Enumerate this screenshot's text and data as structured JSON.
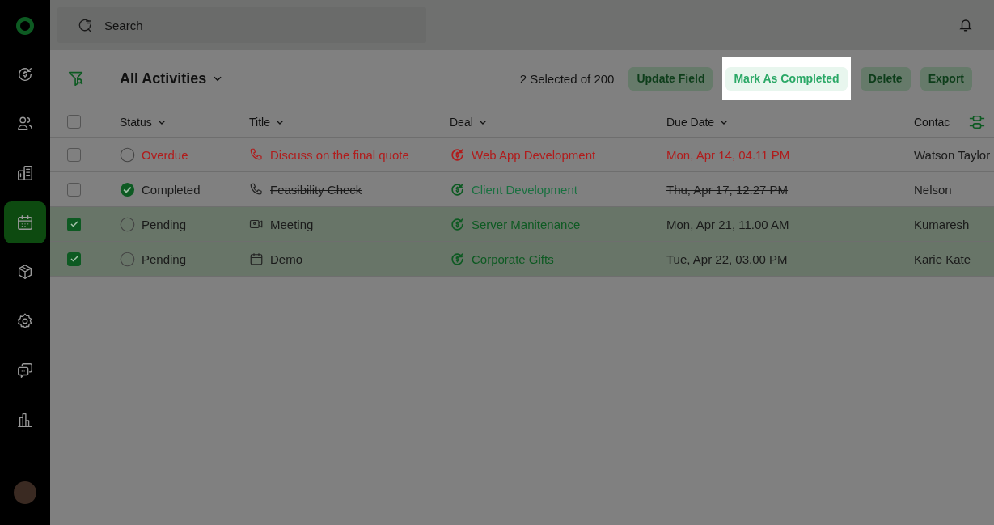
{
  "sidebar": {
    "items": [
      {
        "kind": "deals",
        "selected": false
      },
      {
        "kind": "contacts",
        "selected": false
      },
      {
        "kind": "companies",
        "selected": false
      },
      {
        "kind": "activities",
        "selected": true
      },
      {
        "kind": "products",
        "selected": false
      },
      {
        "kind": "settings",
        "selected": false
      },
      {
        "kind": "chat",
        "selected": false
      },
      {
        "kind": "reports",
        "selected": false
      }
    ]
  },
  "search": {
    "placeholder": "Search"
  },
  "toolbar": {
    "view": "All Activities",
    "selection": "2 Selected of 200",
    "actions": [
      {
        "label": "Update Field",
        "highlighted": false
      },
      {
        "label": "Mark As Completed",
        "highlighted": true
      },
      {
        "label": "Delete",
        "highlighted": false
      },
      {
        "label": "Export",
        "highlighted": false
      }
    ]
  },
  "table": {
    "all_checked": false,
    "columns": [
      "Status",
      "Title",
      "Deal",
      "Due Date",
      "Contac"
    ],
    "rows": [
      {
        "checked": false,
        "status": {
          "kind": "overdue",
          "label": "Overdue"
        },
        "title": {
          "kind": "call",
          "text": "Discuss on the final quote"
        },
        "deal": "Web App Development",
        "due": "Mon, Apr 14, 04.11 PM",
        "contact": "Watson Taylor"
      },
      {
        "checked": false,
        "status": {
          "kind": "completed",
          "label": "Completed"
        },
        "title": {
          "kind": "call",
          "text": "Feasibility Check"
        },
        "deal": "Client Development",
        "due": "Thu, Apr 17, 12.27 PM",
        "contact": "Nelson"
      },
      {
        "checked": true,
        "status": {
          "kind": "pending",
          "label": "Pending"
        },
        "title": {
          "kind": "meeting",
          "text": "Meeting"
        },
        "deal": "Server Manitenance",
        "due": "Mon, Apr 21, 11.00 AM",
        "contact": "Kumaresh"
      },
      {
        "checked": true,
        "status": {
          "kind": "pending",
          "label": "Pending"
        },
        "title": {
          "kind": "demo",
          "text": "Demo"
        },
        "deal": "Corporate Gifts",
        "due": "Tue, Apr 22, 03.00 PM",
        "contact": "Karie Kate"
      }
    ]
  }
}
